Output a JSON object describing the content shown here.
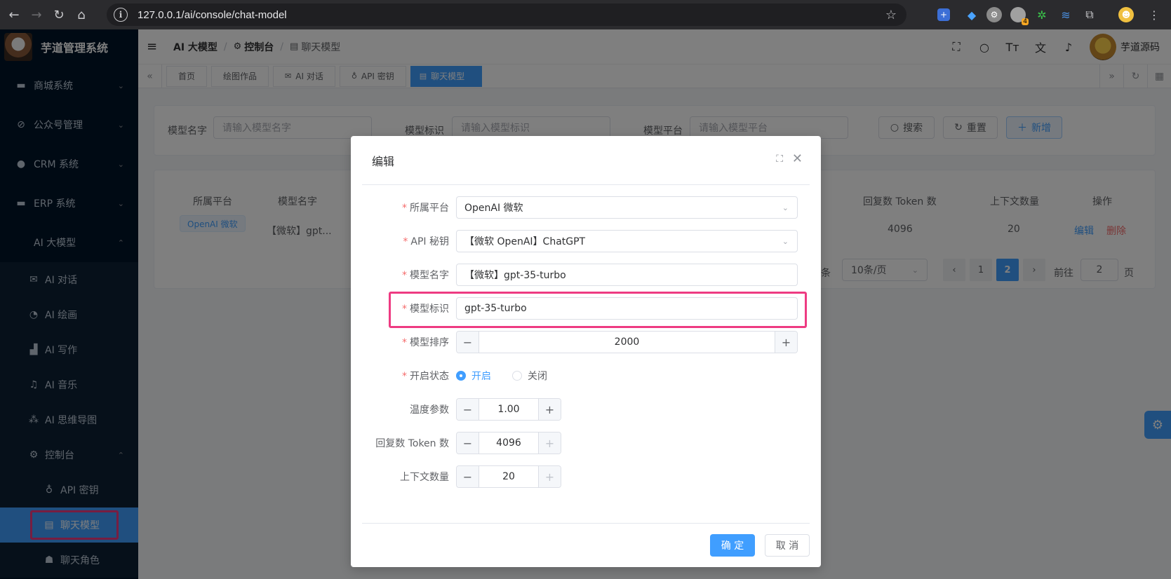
{
  "browser": {
    "url": "127.0.0.1/ai/console/chat-model",
    "ext_badge": "4"
  },
  "sidebar": {
    "title": "芋道管理系统",
    "menu": [
      {
        "label": "商城系统",
        "icon": "shop-icon"
      },
      {
        "label": "公众号管理",
        "icon": "compass-icon"
      },
      {
        "label": "CRM 系统",
        "icon": "user-icon"
      },
      {
        "label": "ERP 系统",
        "icon": "shop-icon"
      },
      {
        "label": "AI 大模型",
        "icon": "apple-icon"
      }
    ],
    "ai_sub": [
      {
        "label": "AI 对话",
        "icon": "mail-icon"
      },
      {
        "label": "AI 绘画",
        "icon": "palette-icon"
      },
      {
        "label": "AI 写作",
        "icon": "book-icon"
      },
      {
        "label": "AI 音乐",
        "icon": "music-icon"
      },
      {
        "label": "AI 思维导图",
        "icon": "hierarchy-icon"
      },
      {
        "label": "控制台",
        "icon": "gear-icon"
      }
    ],
    "console_sub": [
      {
        "label": "API 密钥",
        "icon": "key-icon"
      },
      {
        "label": "聊天模型",
        "icon": "table-icon"
      },
      {
        "label": "聊天角色",
        "icon": "role-icon"
      }
    ]
  },
  "navbar": {
    "breadcrumb": [
      "AI 大模型",
      "控制台",
      "聊天模型"
    ],
    "user_name": "芋道源码"
  },
  "tags": [
    "首页",
    "绘图作品",
    "AI 对话",
    "API 密钥",
    "聊天模型"
  ],
  "search": {
    "name_label": "模型名字",
    "name_placeholder": "请输入模型名字",
    "model_label": "模型标识",
    "model_placeholder": "请输入模型标识",
    "platform_label": "模型平台",
    "platform_placeholder": "请输入模型平台",
    "search_btn": "搜索",
    "reset_btn": "重置",
    "add_btn": "新增"
  },
  "table": {
    "headers": [
      "所属平台",
      "模型名字",
      "回复数 Token 数",
      "上下文数量",
      "操作"
    ],
    "row": {
      "platform": "OpenAI 微软",
      "name": "【微软】gpt...",
      "tokens": "4096",
      "context": "20",
      "edit": "编辑",
      "delete": "删除"
    }
  },
  "pagination": {
    "total_suffix": "条",
    "page_size": "10条/页",
    "pages": [
      "1",
      "2"
    ],
    "current": "2",
    "goto_label": "前往",
    "goto_value": "2",
    "page_suffix": "页"
  },
  "dialog": {
    "title": "编辑",
    "fields": {
      "platform": {
        "label": "所属平台",
        "value": "OpenAI 微软"
      },
      "api_key": {
        "label": "API 秘钥",
        "value": "【微软 OpenAI】ChatGPT"
      },
      "model_name": {
        "label": "模型名字",
        "value": "【微软】gpt-35-turbo"
      },
      "model_id": {
        "label": "模型标识",
        "value": "gpt-35-turbo"
      },
      "sort": {
        "label": "模型排序",
        "value": "2000"
      },
      "status": {
        "label": "开启状态",
        "on": "开启",
        "off": "关闭",
        "selected": "开启"
      },
      "temperature": {
        "label": "温度参数",
        "value": "1.00"
      },
      "max_tokens": {
        "label": "回复数 Token 数",
        "value": "4096"
      },
      "max_contexts": {
        "label": "上下文数量",
        "value": "20"
      }
    },
    "ok": "确 定",
    "cancel": "取 消"
  }
}
